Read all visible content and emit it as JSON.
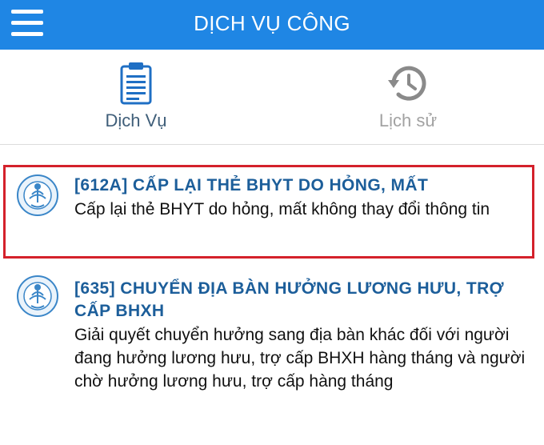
{
  "header": {
    "title": "DỊCH VỤ CÔNG",
    "menu_icon": "hamburger-menu-icon",
    "background_color": "#1f86e4"
  },
  "tabs": [
    {
      "label": "Dịch Vụ",
      "icon": "clipboard-icon",
      "active": true
    },
    {
      "label": "Lịch sử",
      "icon": "history-icon",
      "active": false
    }
  ],
  "services": [
    {
      "title": "[612A] CẤP LẠI THẺ BHYT DO HỎNG, MẤT",
      "description": "Cấp lại thẻ BHYT do hỏng, mất không thay đổi thông tin",
      "icon": "bhxh-logo-icon",
      "highlighted": true
    },
    {
      "title": "[635] CHUYỂN ĐỊA BÀN HƯỞNG LƯƠNG HƯU, TRỢ CẤP BHXH",
      "description": "Giải quyết chuyển hưởng sang địa bàn khác đối với người đang hưởng lương hưu, trợ cấp BHXH hàng tháng và người chờ hưởng lương hưu, trợ cấp hàng tháng",
      "icon": "bhxh-logo-icon",
      "highlighted": false
    }
  ],
  "colors": {
    "accent": "#1f86e4",
    "title_text": "#1c5e9a",
    "highlight_border": "#d4212b",
    "inactive_tab": "#a2a2a2"
  }
}
